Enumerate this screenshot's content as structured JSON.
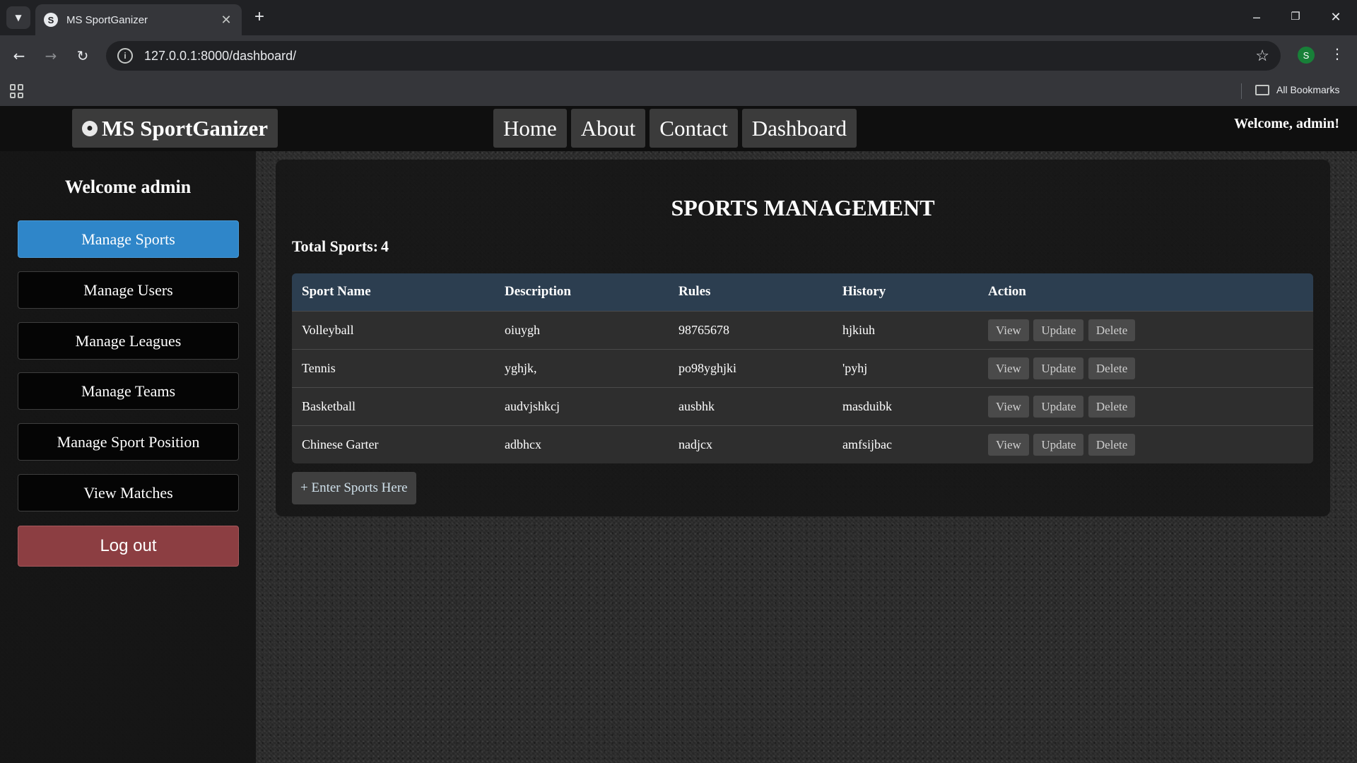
{
  "browser": {
    "tab_title": "MS SportGanizer",
    "favicon_glyph": "S",
    "url": "127.0.0.1:8000/dashboard/",
    "profile_initial": "S",
    "all_bookmarks": "All Bookmarks"
  },
  "header": {
    "brand": "MS SportGanizer",
    "nav": [
      "Home",
      "About",
      "Contact",
      "Dashboard"
    ],
    "welcome": "Welcome, admin!"
  },
  "sidebar": {
    "title": "Welcome admin",
    "items": [
      {
        "label": "Manage Sports"
      },
      {
        "label": "Manage Users"
      },
      {
        "label": "Manage Leagues"
      },
      {
        "label": "Manage Teams"
      },
      {
        "label": "Manage Sport Position"
      },
      {
        "label": "View Matches"
      }
    ],
    "logout": "Log out",
    "active_color": "#2f86c9",
    "logout_color": "#8c3e42"
  },
  "main": {
    "title": "SPORTS MANAGEMENT",
    "total_label": "Total Sports:",
    "total_value": "4",
    "columns": [
      "Sport Name",
      "Description",
      "Rules",
      "History",
      "Action"
    ],
    "rows": [
      {
        "name": "Volleyball",
        "description": "oiuygh",
        "rules": "98765678",
        "history": "hjkiuh"
      },
      {
        "name": "Tennis",
        "description": "yghjk,",
        "rules": "po98yghjki",
        "history": "'pyhj"
      },
      {
        "name": "Basketball",
        "description": "audvjshkcj",
        "rules": "ausbhk",
        "history": "masduibk"
      },
      {
        "name": "Chinese Garter",
        "description": "adbhcx",
        "rules": "nadjcx",
        "history": "amfsijbac"
      }
    ],
    "actions": {
      "view": "View",
      "update": "Update",
      "delete": "Delete"
    },
    "add_button": "+ Enter Sports Here",
    "table_header_color": "#2c3e50"
  }
}
